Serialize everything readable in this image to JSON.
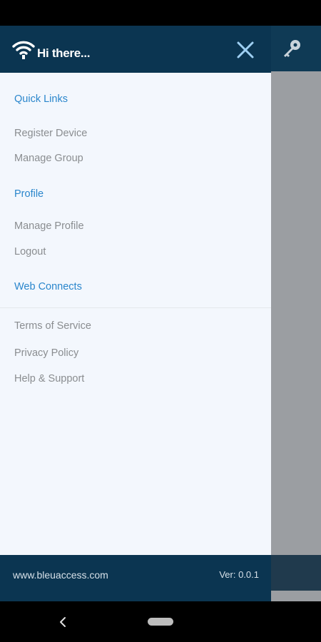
{
  "header": {
    "greeting": "Hi there..."
  },
  "sections": [
    {
      "label": "Quick Links",
      "items": [
        "Register Device",
        "Manage Group"
      ]
    },
    {
      "label": "Profile",
      "items": [
        "Manage Profile",
        "Logout"
      ]
    },
    {
      "label": "Web Connects",
      "items": []
    }
  ],
  "links": [
    "Terms of Service",
    "Privacy Policy",
    "Help & Support"
  ],
  "footer": {
    "website": "www.bleuaccess.com",
    "version": "Ver: 0.0.1"
  },
  "colors": {
    "header": "#0b3551",
    "accent": "#2a86cc",
    "drawer_bg": "#f3f7fd",
    "item_text": "#8a8d90"
  },
  "icons": {
    "header": "wifi-icon",
    "close": "close-icon",
    "background": "key-icon",
    "nav_back": "back-icon"
  }
}
